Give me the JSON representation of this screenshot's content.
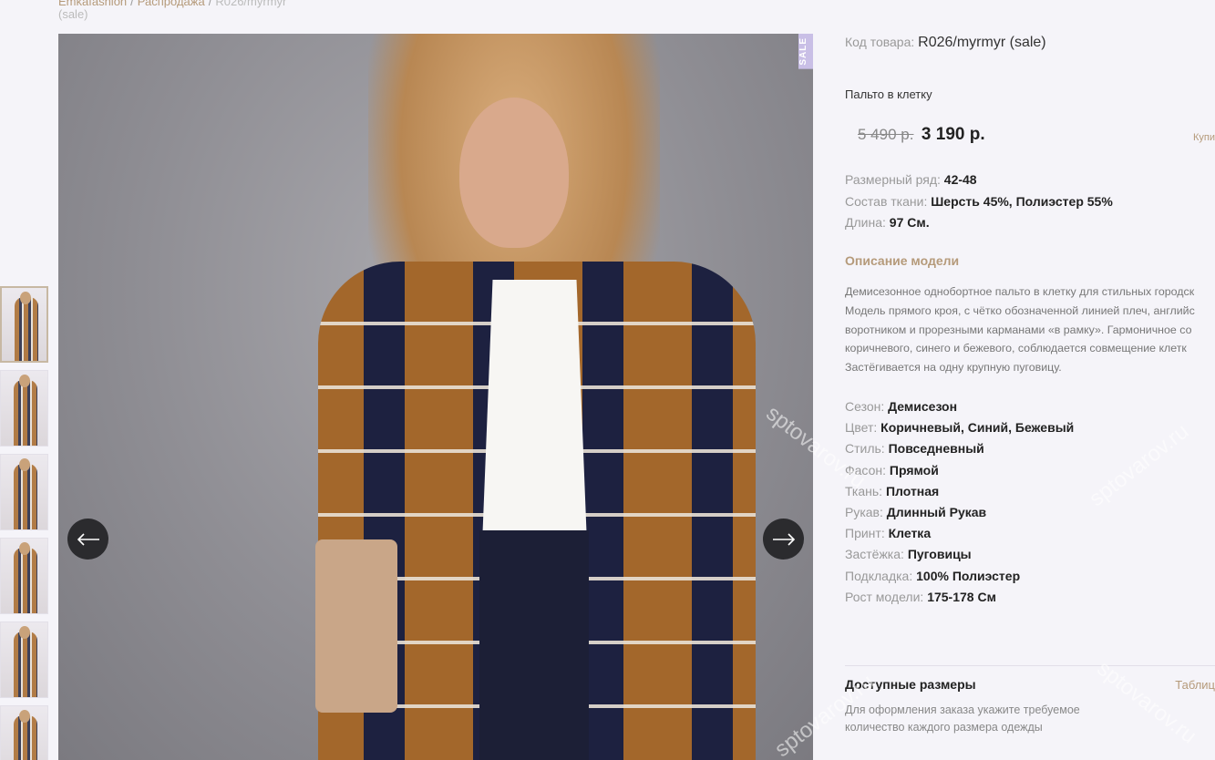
{
  "breadcrumb": {
    "items": [
      "Emkafashion",
      "Распродажа"
    ],
    "current_line1": "R026/myrmyr",
    "current_line2": "(sale)",
    "separator": "/"
  },
  "gallery": {
    "sale_label": "SALE",
    "thumbnail_count": 6
  },
  "product": {
    "sku_label": "Код товара:",
    "sku_value": "R026/myrmyr (sale)",
    "name": "Пальто в клетку",
    "old_price": "5 490 р.",
    "new_price": "3 190 р.",
    "buy_link": "Купи",
    "specs": [
      {
        "label": "Размерный ряд:",
        "value": "42-48"
      },
      {
        "label": "Состав ткани:",
        "value": "Шерсть 45%, Полиэстер 55%"
      },
      {
        "label": "Длина:",
        "value": "97 См."
      }
    ],
    "description_title": "Описание модели",
    "description_lines": [
      "Демисезонное однобортное пальто в клетку для стильных городск",
      "Модель прямого кроя, с чётко обозначенной линией плеч, английс",
      "воротником и прорезными карманами «в рамку». Гармоничное со",
      "коричневого, синего и бежевого, соблюдается совмещение клетк",
      "Застёгивается на одну крупную пуговицу."
    ],
    "attributes": [
      {
        "label": "Сезон:",
        "value": "Демисезон"
      },
      {
        "label": "Цвет:",
        "value": "Коричневый, Синий, Бежевый"
      },
      {
        "label": "Стиль:",
        "value": "Повседневный"
      },
      {
        "label": "Фасон:",
        "value": "Прямой"
      },
      {
        "label": "Ткань:",
        "value": "Плотная"
      },
      {
        "label": "Рукав:",
        "value": "Длинный Рукав"
      },
      {
        "label": "Принт:",
        "value": "Клетка"
      },
      {
        "label": "Застёжка:",
        "value": "Пуговицы"
      },
      {
        "label": "Подкладка:",
        "value": "100% Полиэстер"
      },
      {
        "label": "Рост модели:",
        "value": "175-178 См"
      }
    ],
    "sizes_title": "Доступные размеры",
    "sizes_link": "Таблиц",
    "sizes_note": "Для оформления заказа укажите требуемое количество каждого размера одежды"
  },
  "watermark": "sptovarov.ru",
  "colors": {
    "accent": "#b59a7a",
    "background": "#f5f4f9",
    "nav_button": "#2b2b2e"
  }
}
